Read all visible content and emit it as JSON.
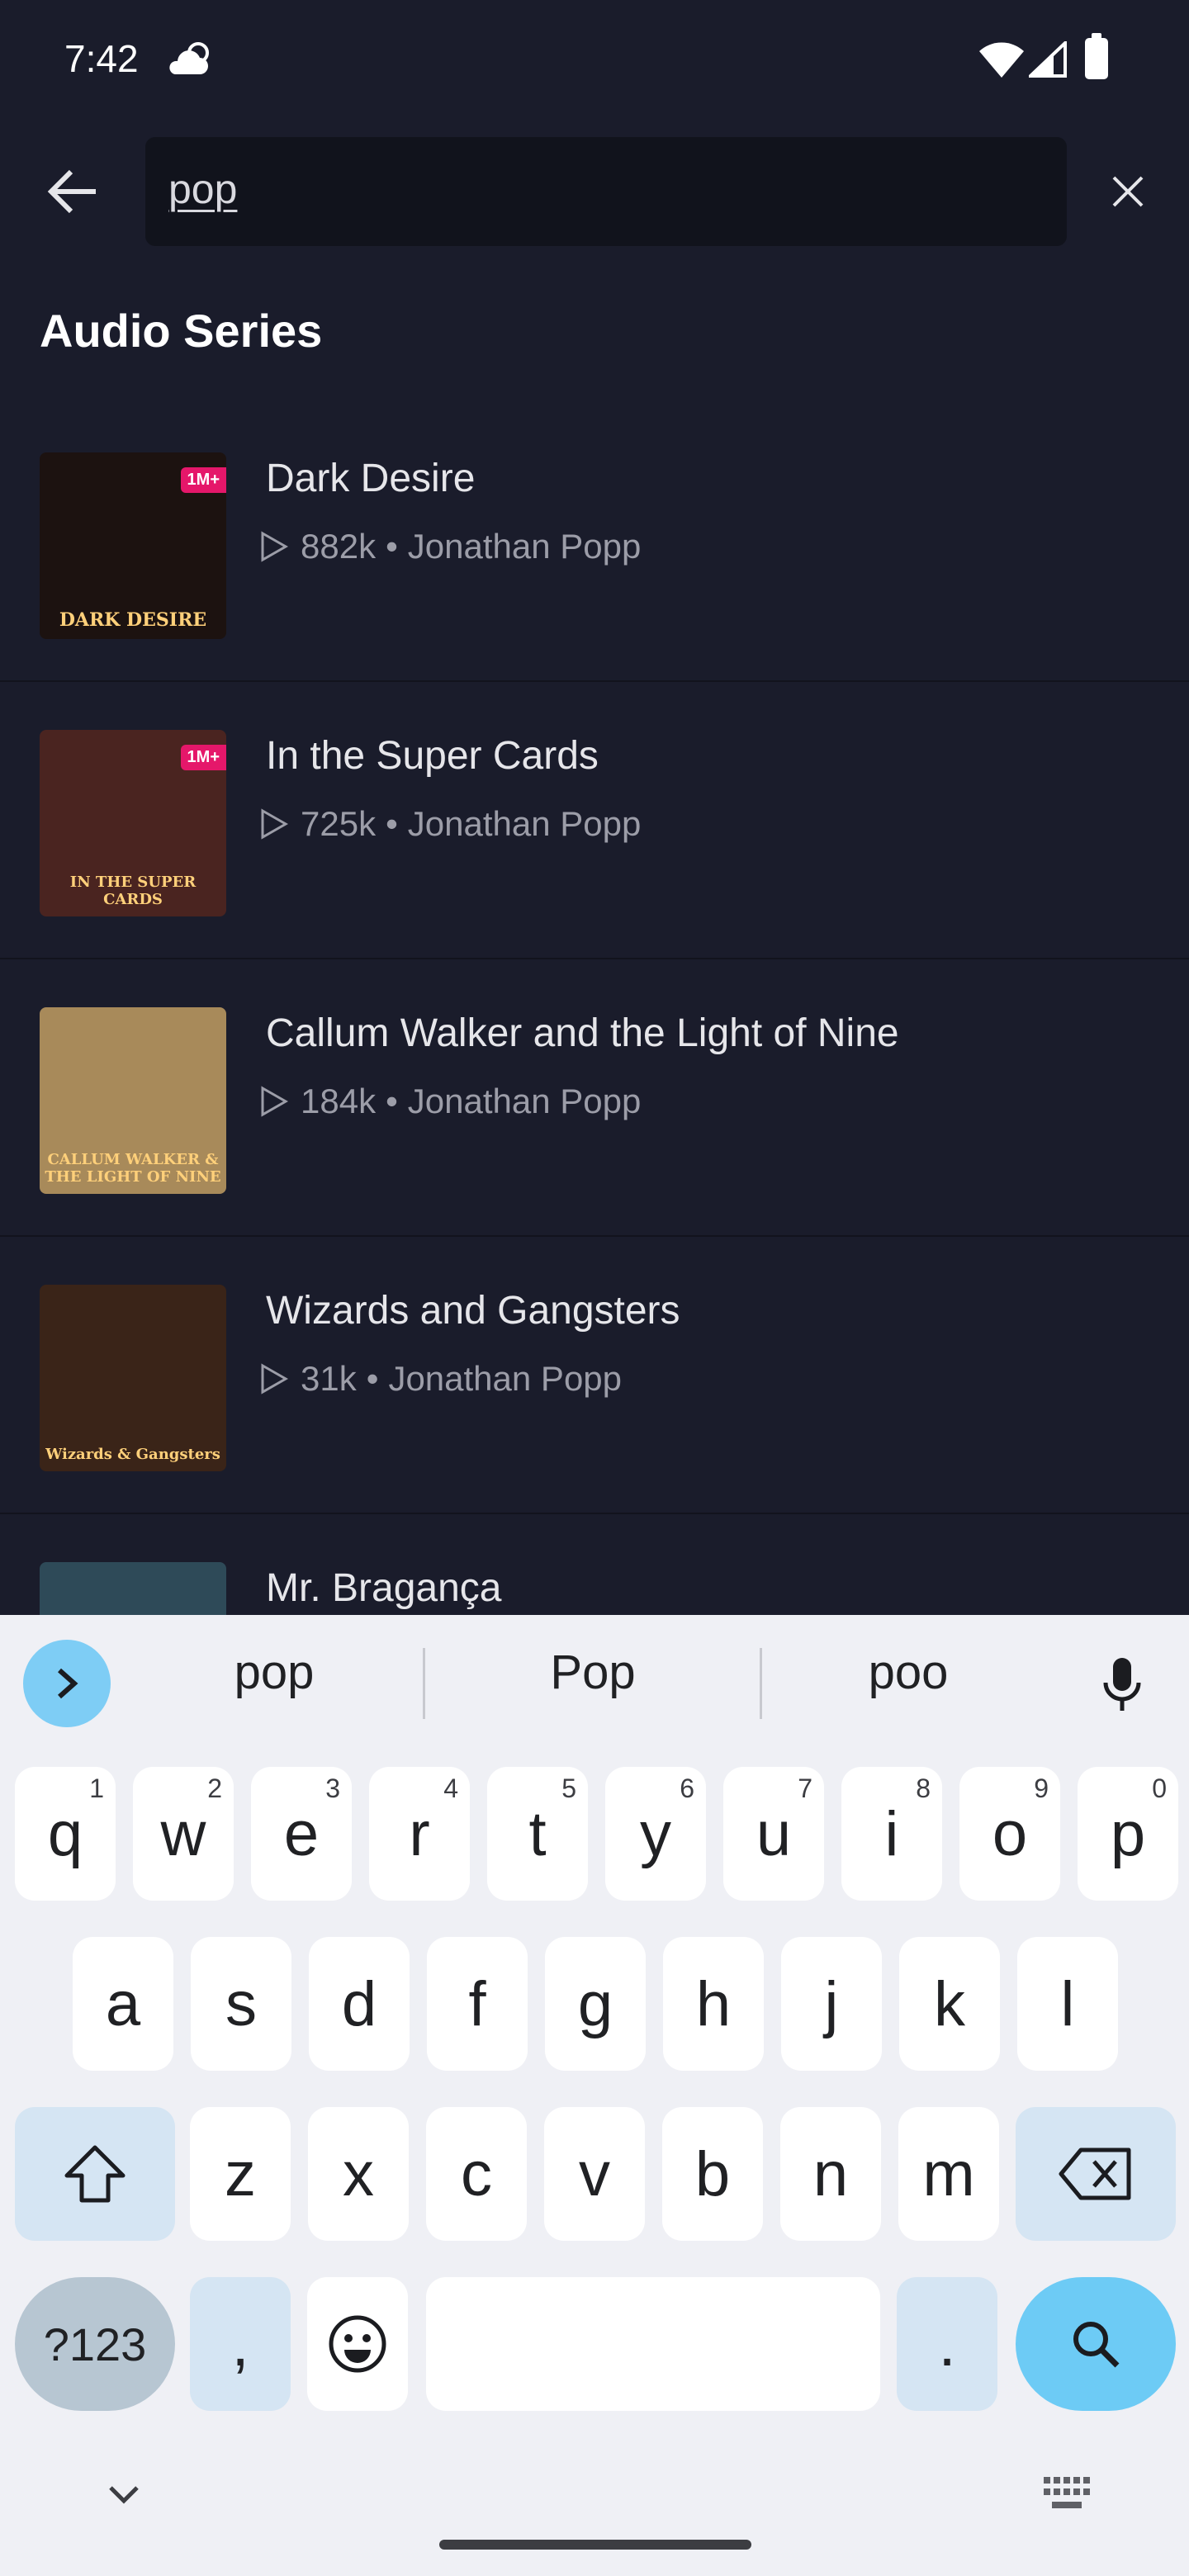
{
  "status": {
    "time": "7:42"
  },
  "search": {
    "query": "pop"
  },
  "section": {
    "title": "Audio Series"
  },
  "results": [
    {
      "title": "Dark Desire",
      "plays": "882k",
      "author": "Jonathan Popp",
      "badge": "1M+",
      "cover_text": "DARK DESIRE",
      "cover_bg": "#1c1210"
    },
    {
      "title": "In the Super Cards",
      "plays": "725k",
      "author": "Jonathan Popp",
      "badge": "1M+",
      "cover_text": "IN THE SUPER CARDS",
      "cover_bg": "#4a2420"
    },
    {
      "title": "Callum Walker and the Light of Nine",
      "plays": "184k",
      "author": "Jonathan Popp",
      "badge": "",
      "cover_text": "CALLUM WALKER & THE LIGHT OF NINE",
      "cover_bg": "#a88a5a"
    },
    {
      "title": "Wizards and Gangsters",
      "plays": "31k",
      "author": "Jonathan Popp",
      "badge": "",
      "cover_text": "Wizards & Gangsters",
      "cover_bg": "#3a2418"
    },
    {
      "title": "Mr. Bragança",
      "plays": "",
      "author": "",
      "badge": "",
      "cover_text": "",
      "cover_bg": "#2e4a58"
    }
  ],
  "meta_separator": "•",
  "keyboard": {
    "suggestions": [
      "pop",
      "Pop",
      "poo"
    ],
    "row1": [
      {
        "k": "q",
        "h": "1"
      },
      {
        "k": "w",
        "h": "2"
      },
      {
        "k": "e",
        "h": "3"
      },
      {
        "k": "r",
        "h": "4"
      },
      {
        "k": "t",
        "h": "5"
      },
      {
        "k": "y",
        "h": "6"
      },
      {
        "k": "u",
        "h": "7"
      },
      {
        "k": "i",
        "h": "8"
      },
      {
        "k": "o",
        "h": "9"
      },
      {
        "k": "p",
        "h": "0"
      }
    ],
    "row2": [
      "a",
      "s",
      "d",
      "f",
      "g",
      "h",
      "j",
      "k",
      "l"
    ],
    "row3": [
      "z",
      "x",
      "c",
      "v",
      "b",
      "n",
      "m"
    ],
    "symbols_label": "?123",
    "comma": ",",
    "period": "."
  },
  "colors": {
    "background": "#1a1c2b",
    "keyboard_bg": "#eff0f5",
    "accent": "#6dcbf5",
    "badge": "#e5176a"
  }
}
